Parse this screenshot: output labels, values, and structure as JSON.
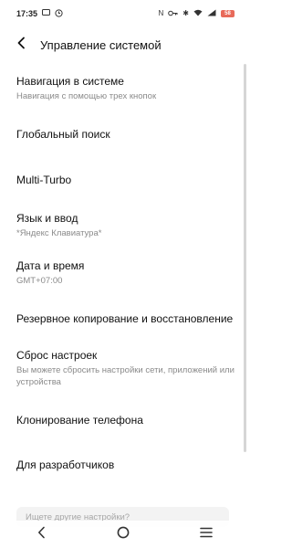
{
  "status_bar": {
    "time": "17:35",
    "battery_level": "58"
  },
  "header": {
    "title": "Управление системой"
  },
  "settings": {
    "navigation": {
      "title": "Навигация в системе",
      "subtitle": "Навигация с помощью трех кнопок"
    },
    "global_search": {
      "title": "Глобальный поиск"
    },
    "multi_turbo": {
      "title": "Multi-Turbo"
    },
    "language_input": {
      "title": "Язык и ввод",
      "subtitle": "*Яндекс Клавиатура*"
    },
    "date_time": {
      "title": "Дата и время",
      "subtitle": "GMT+07:00"
    },
    "backup_restore": {
      "title": "Резервное копирование и восстановление"
    },
    "reset": {
      "title": "Сброс настроек",
      "subtitle": "Вы можете сбросить настройки сети, приложений или устройства"
    },
    "phone_clone": {
      "title": "Клонирование телефона"
    },
    "developer": {
      "title": "Для разработчиков"
    }
  },
  "search": {
    "placeholder": "Ищете другие настройки?"
  },
  "colors": {
    "background": "#ffffff",
    "text_primary": "#111111",
    "text_secondary": "#8a8a8a",
    "battery": "#e86a5a"
  },
  "icons": {
    "back": "chevron-left-icon",
    "nav_back": "nav-back-icon",
    "nav_home": "nav-home-icon",
    "nav_recents": "nav-recents-icon"
  }
}
